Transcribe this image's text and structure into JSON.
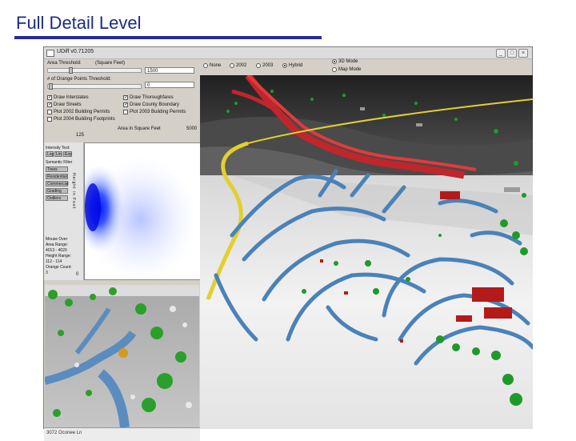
{
  "slide": {
    "title": "Full Detail Level"
  },
  "window": {
    "title": "UDiff v0.71205",
    "buttons": {
      "minimize": "_",
      "maximize": "□",
      "close": "×"
    }
  },
  "controls": {
    "area_threshold_label": "Area Threshold:",
    "area_unit_label": "(Square Feet)",
    "area_threshold_value": "1500",
    "orange_threshold_label": "# of Orange Points Threshold:",
    "orange_threshold_value": "0",
    "checkboxes": [
      {
        "label": "Draw Interstates",
        "checked": true
      },
      {
        "label": "Draw Streets",
        "checked": true
      },
      {
        "label": "Plot 2002 Building Permits",
        "checked": false
      },
      {
        "label": "Plot 2004 Building Footprints",
        "checked": false
      },
      {
        "label": "Draw Thoroughfares",
        "checked": true
      },
      {
        "label": "Draw County Boundary",
        "checked": true
      },
      {
        "label": "Plot 2003 Building Permits",
        "checked": false
      }
    ]
  },
  "image_options": {
    "radios": [
      {
        "label": "None",
        "selected": false
      },
      {
        "label": "2002",
        "selected": false
      },
      {
        "label": "2003",
        "selected": false
      },
      {
        "label": "Hybrid",
        "selected": true
      }
    ],
    "modes": [
      {
        "label": "3D Mode",
        "selected": true
      },
      {
        "label": "Map Mode",
        "selected": false
      }
    ]
  },
  "scatter": {
    "x_axis_title": "Area in Square Feet",
    "x_max_label": "5000",
    "y_top_label": "125",
    "y_bottom_label": "0",
    "y_axis_vertical": "Height in Feet"
  },
  "sidebar": {
    "intensity_label": "Intensity Test:",
    "intensity_buttons": [
      "Log",
      "Lin",
      "Exp"
    ],
    "filter_title": "Semantic Filter",
    "filter_buttons": [
      "Trees",
      "Residential",
      "Commercial",
      "Grading",
      "Outliers"
    ],
    "mouse_over": "Mouse Over",
    "area_range_label": "Area Range:",
    "area_range_value": "4013 - 4020",
    "height_range_label": "Height Range:",
    "height_range_value": "112 - 114",
    "orange_count_label": "Orange Count:",
    "orange_count_value": "3"
  },
  "statusbar": {
    "text": "3072 Oconee Ln"
  },
  "colors": {
    "title": "#1a2a8a",
    "street": "#4a82b8",
    "interstate": "#d02a2a",
    "county_boundary": "#e0d030",
    "trees": "#1e9a2a",
    "buildings": "#b31a1a",
    "scatter_points": "#1a3aff"
  }
}
